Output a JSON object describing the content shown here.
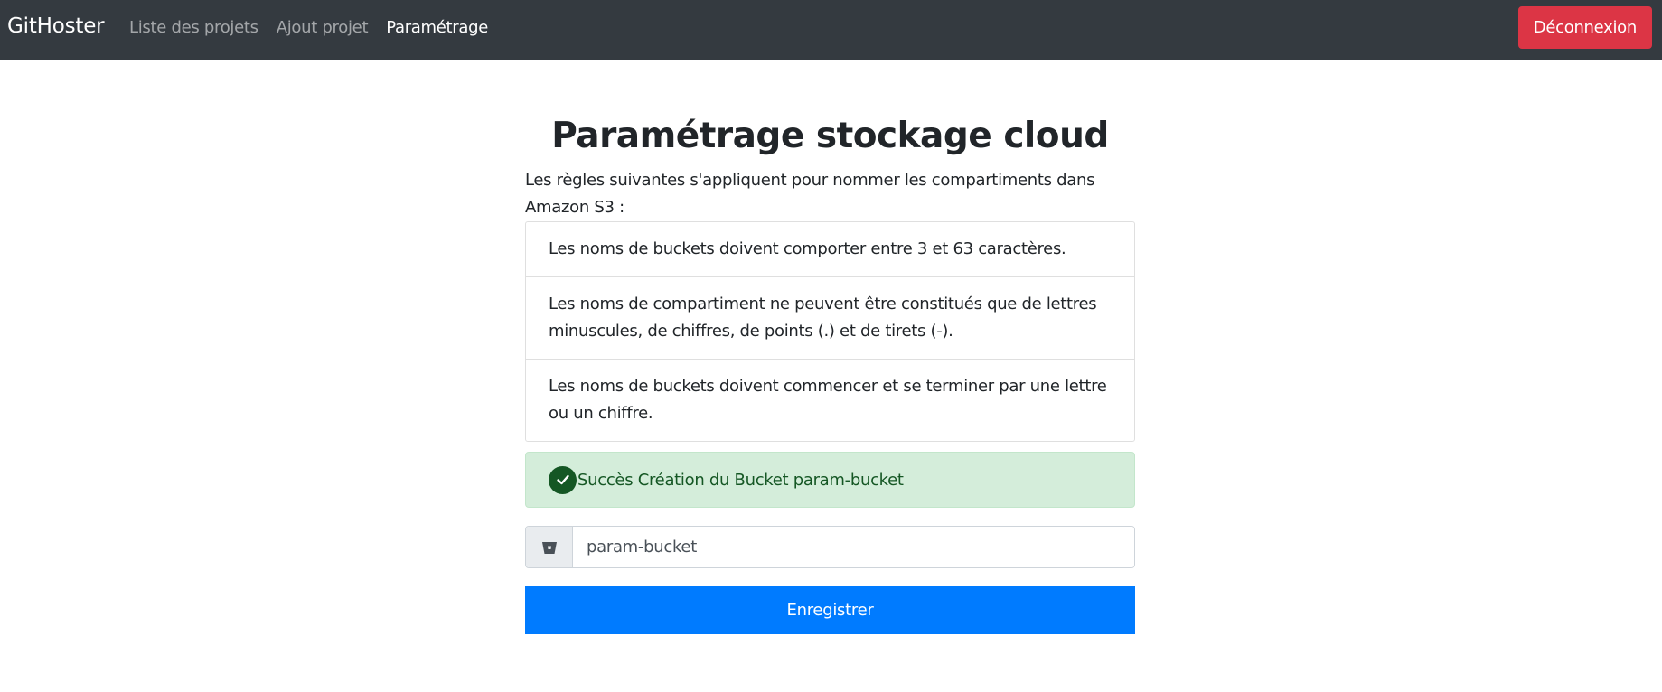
{
  "navbar": {
    "brand": "GitHoster",
    "links": [
      {
        "label": "Liste des projets",
        "active": false
      },
      {
        "label": "Ajout projet",
        "active": false
      },
      {
        "label": "Paramétrage",
        "active": true
      }
    ],
    "logout_label": "Déconnexion"
  },
  "main": {
    "title": "Paramétrage stockage cloud",
    "intro": "Les règles suivantes s'appliquent pour nommer les compartiments dans Amazon S3 :",
    "rules": [
      "Les noms de buckets doivent comporter entre 3 et 63 caractères.",
      "Les noms de compartiment ne peuvent être constitués que de lettres minuscules, de chiffres, de points (.) et de tirets (-).",
      "Les noms de buckets doivent commencer et se terminer par une lettre ou un chiffre."
    ],
    "alert": {
      "icon": "check-circle-icon",
      "text": "Succès Création du Bucket param-bucket"
    },
    "bucket_field": {
      "icon": "bucket-icon",
      "value": "param-bucket"
    },
    "submit_label": "Enregistrer"
  },
  "colors": {
    "navbar_bg": "#343a40",
    "danger": "#dc3545",
    "primary": "#007bff",
    "success_bg": "#d4edda",
    "success_text": "#155724"
  }
}
